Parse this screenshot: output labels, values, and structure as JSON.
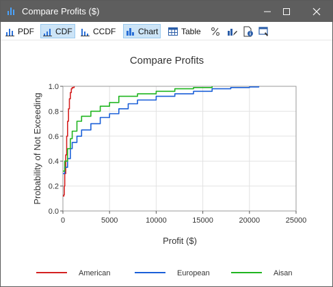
{
  "window": {
    "title": "Compare Profits ($)",
    "icons": {
      "app": "bar-chart-icon",
      "minimize": "minimize-icon",
      "maximize": "maximize-icon",
      "close": "close-icon"
    }
  },
  "toolbar": {
    "pdf_label": "PDF",
    "cdf_label": "CDF",
    "ccdf_label": "CCDF",
    "chart_label": "Chart",
    "table_label": "Table",
    "icons": [
      "pdf-icon",
      "cdf-icon",
      "ccdf-icon",
      "chart-icon",
      "table-icon",
      "percent-icon",
      "edit-icon",
      "info-icon",
      "settings-icon"
    ],
    "active": [
      "cdf",
      "chart"
    ]
  },
  "colors": {
    "american": "#d42020",
    "european": "#1a5fd8",
    "aisan": "#1fb51f",
    "titlebar": "#5e5e5e",
    "active_bg": "#cce4f7"
  },
  "chart_data": {
    "type": "line",
    "title": "Compare Profits",
    "xlabel": "Profit ($)",
    "ylabel": "Probability of Not Exceeding",
    "xlim": [
      0,
      25000
    ],
    "ylim": [
      0,
      1.0
    ],
    "xticks": [
      0,
      5000,
      10000,
      15000,
      20000,
      25000
    ],
    "yticks": [
      0.0,
      0.2,
      0.4,
      0.6,
      0.8,
      1.0
    ],
    "ytick_labels": [
      "0.0",
      "0.2",
      "0.4",
      "0.6",
      "0.8",
      "1.0"
    ],
    "grid": true,
    "legend": "bottom",
    "series": [
      {
        "name": "American",
        "color": "#d42020",
        "x": [
          0,
          100,
          150,
          200,
          300,
          400,
          500,
          600,
          700,
          800,
          900,
          1000,
          1200
        ],
        "y": [
          0.12,
          0.13,
          0.2,
          0.3,
          0.45,
          0.6,
          0.72,
          0.82,
          0.9,
          0.95,
          0.98,
          0.99,
          1.0
        ]
      },
      {
        "name": "European",
        "color": "#1a5fd8",
        "x": [
          0,
          200,
          500,
          800,
          1000,
          1500,
          2000,
          3000,
          4000,
          5000,
          6000,
          7000,
          8000,
          10000,
          12000,
          14000,
          16000,
          18000,
          20000,
          21000
        ],
        "y": [
          0.3,
          0.35,
          0.42,
          0.5,
          0.55,
          0.6,
          0.65,
          0.7,
          0.75,
          0.78,
          0.82,
          0.86,
          0.89,
          0.92,
          0.94,
          0.96,
          0.98,
          0.99,
          0.995,
          1.0
        ]
      },
      {
        "name": "Aisan",
        "color": "#1fb51f",
        "x": [
          0,
          200,
          500,
          800,
          1000,
          1500,
          2000,
          3000,
          4000,
          5000,
          6000,
          8000,
          10000,
          12000,
          14000,
          16000
        ],
        "y": [
          0.32,
          0.4,
          0.5,
          0.58,
          0.64,
          0.72,
          0.76,
          0.8,
          0.84,
          0.87,
          0.92,
          0.94,
          0.96,
          0.98,
          0.99,
          1.0
        ]
      }
    ]
  }
}
